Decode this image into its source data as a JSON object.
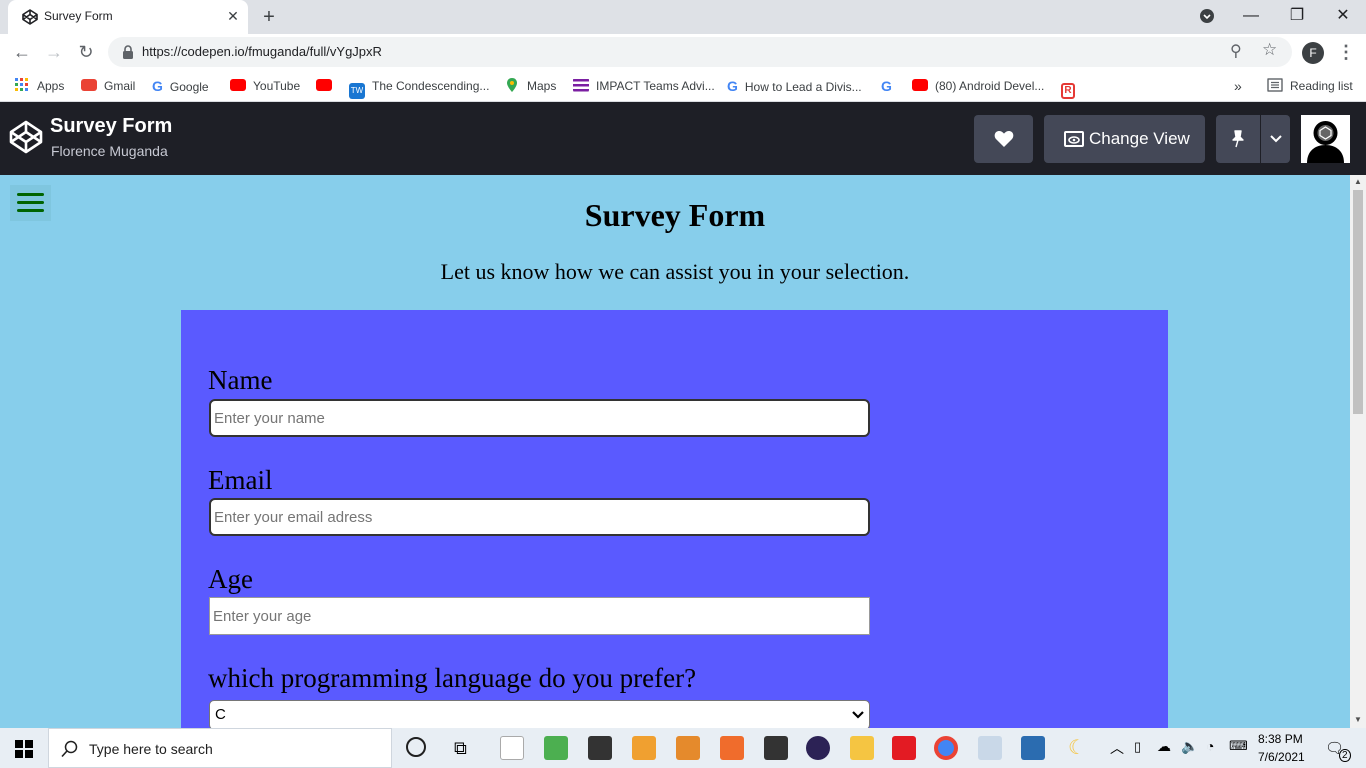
{
  "browser": {
    "tab_title": "Survey Form",
    "url": "https://codepen.io/fmuganda/full/vYgJpxR",
    "profile_initial": "F",
    "bookmarks": [
      {
        "label": "Apps",
        "icon": "apps-grid-icon",
        "color": "#4285f4"
      },
      {
        "label": "Gmail",
        "icon": "gmail-icon",
        "color": "#ea4335"
      },
      {
        "label": "Google",
        "icon": "google-icon",
        "color": "#4285f4"
      },
      {
        "label": "YouTube",
        "icon": "youtube-icon",
        "color": "#ff0000"
      },
      {
        "label": "",
        "icon": "youtube-icon",
        "color": "#ff0000"
      },
      {
        "label": "The Condescending...",
        "icon": "tw-icon",
        "color": "#1976d2"
      },
      {
        "label": "Maps",
        "icon": "maps-pin-icon",
        "color": "#34a853"
      },
      {
        "label": "IMPACT Teams Advi...",
        "icon": "impact-icon",
        "color": "#7b1fa2"
      },
      {
        "label": "How to Lead a Divis...",
        "icon": "google-icon",
        "color": "#4285f4"
      },
      {
        "label": "",
        "icon": "google-icon",
        "color": "#4285f4"
      },
      {
        "label": "(80) Android Devel...",
        "icon": "youtube-icon",
        "color": "#ff0000"
      },
      {
        "label": "",
        "icon": "r-icon",
        "color": "#e53935"
      }
    ],
    "reading_list": "Reading list",
    "more_bookmarks": "»"
  },
  "codepen": {
    "title": "Survey Form",
    "author": "Florence Muganda",
    "change_view_label": "Change View"
  },
  "page": {
    "title": "Survey Form",
    "description": "Let us know how we can assist you in your selection.",
    "fields": {
      "name_label": "Name",
      "name_placeholder": "Enter your name",
      "email_label": "Email",
      "email_placeholder": "Enter your email adress",
      "age_label": "Age",
      "age_placeholder": "Enter your age",
      "language_label": "which programming language do you prefer?",
      "language_value": "C"
    },
    "colors": {
      "background": "#87CEEB",
      "form_panel": "#5a5aff",
      "menu_icon": "#006400"
    }
  },
  "taskbar": {
    "search_placeholder": "Type here to search",
    "time": "8:38 PM",
    "date": "7/6/2021",
    "notification_count": "2"
  }
}
